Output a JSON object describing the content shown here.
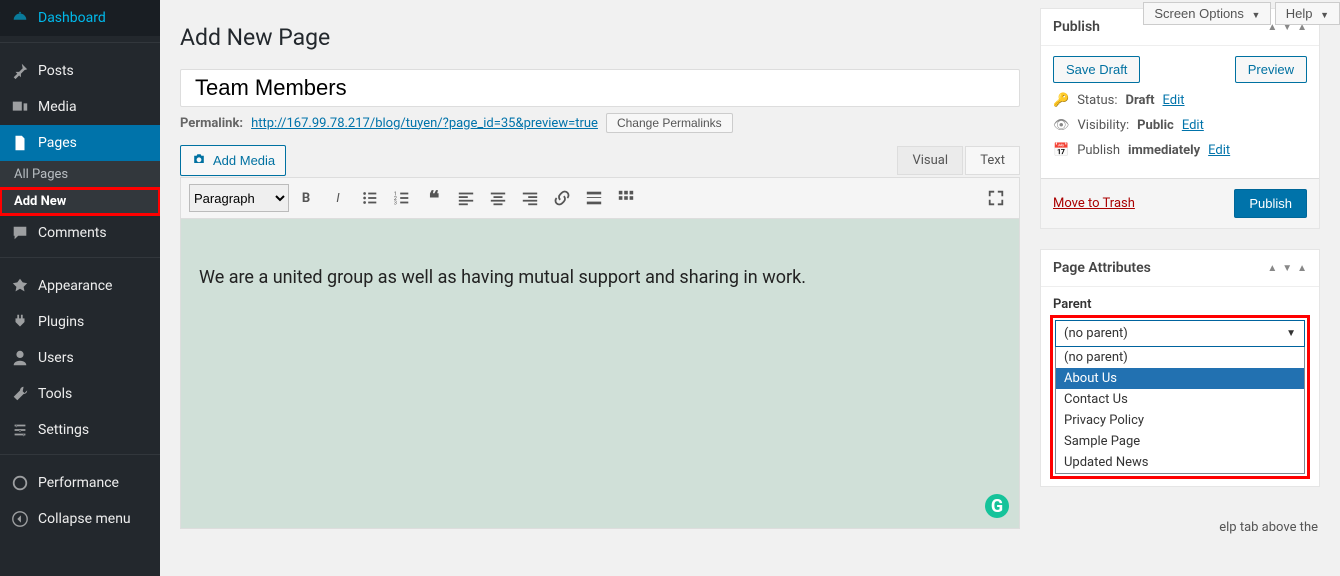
{
  "top_controls": {
    "screen_options": "Screen Options",
    "help": "Help"
  },
  "sidebar": {
    "items": [
      {
        "icon": "dashboard",
        "label": "Dashboard"
      },
      {
        "icon": "pin",
        "label": "Posts"
      },
      {
        "icon": "media",
        "label": "Media"
      },
      {
        "icon": "pages",
        "label": "Pages"
      },
      {
        "icon": "comment",
        "label": "Comments"
      },
      {
        "icon": "appearance",
        "label": "Appearance"
      },
      {
        "icon": "plugins",
        "label": "Plugins"
      },
      {
        "icon": "users",
        "label": "Users"
      },
      {
        "icon": "tools",
        "label": "Tools"
      },
      {
        "icon": "settings",
        "label": "Settings"
      },
      {
        "icon": "perf",
        "label": "Performance"
      },
      {
        "icon": "collapse",
        "label": "Collapse menu"
      }
    ],
    "sub_pages": [
      "All Pages",
      "Add New"
    ]
  },
  "page": {
    "heading": "Add New Page",
    "title_value": "Team Members",
    "permalink_label": "Permalink:",
    "permalink_url": "http://167.99.78.217/blog/tuyen/?page_id=35&preview=true",
    "change_permalinks": "Change Permalinks",
    "add_media": "Add Media",
    "tabs": {
      "visual": "Visual",
      "text": "Text"
    },
    "format_select": "Paragraph",
    "body_text": "We are a united group as well as having mutual support and sharing in work."
  },
  "publish": {
    "title": "Publish",
    "save_draft": "Save Draft",
    "preview": "Preview",
    "status_label": "Status:",
    "status_value": "Draft",
    "visibility_label": "Visibility:",
    "visibility_value": "Public",
    "publish_time_label": "Publish",
    "publish_time_value": "immediately",
    "edit": "Edit",
    "trash": "Move to Trash",
    "publish_btn": "Publish"
  },
  "attributes": {
    "title": "Page Attributes",
    "parent_label": "Parent",
    "selected": "(no parent)",
    "options": [
      "(no parent)",
      "About Us",
      "Contact Us",
      "Privacy Policy",
      "Sample Page",
      "Updated News"
    ],
    "highlighted": "About Us",
    "help_snippet": "elp tab above the"
  }
}
